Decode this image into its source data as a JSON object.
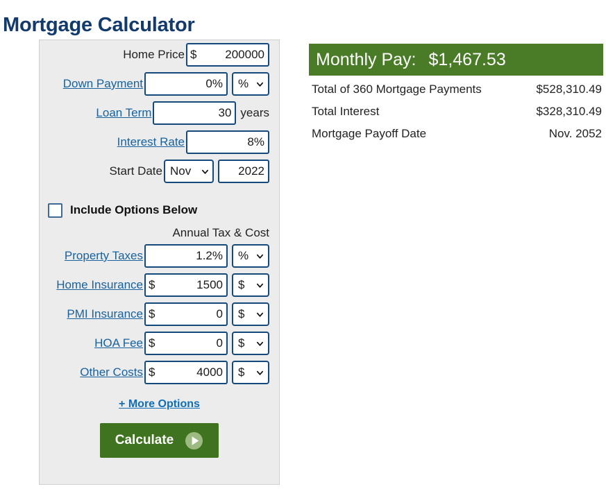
{
  "page": {
    "title": "Mortgage Calculator"
  },
  "calculator": {
    "fields": [
      {
        "id": "home-price",
        "label": "Home Price",
        "is_link": false,
        "prefix": "$",
        "value": "200000",
        "select": null,
        "suffix": null
      },
      {
        "id": "down-payment",
        "label": "Down Payment",
        "is_link": true,
        "prefix": "",
        "value": "0%",
        "select": "%",
        "suffix": null
      },
      {
        "id": "loan-term",
        "label": "Loan Term",
        "is_link": true,
        "prefix": "",
        "value": "30",
        "select": null,
        "suffix": "years"
      },
      {
        "id": "interest-rate",
        "label": "Interest Rate",
        "is_link": true,
        "prefix": "",
        "value": "8%",
        "select": null,
        "suffix": null
      }
    ],
    "start_date": {
      "label": "Start Date",
      "month": "Nov",
      "year": "2022"
    },
    "include_options": {
      "label": "Include Options Below",
      "checked": false
    },
    "annual_heading": "Annual Tax & Cost",
    "option_fields": [
      {
        "id": "property-taxes",
        "label": "Property Taxes",
        "is_link": true,
        "prefix": "",
        "value": "1.2%",
        "select": "%"
      },
      {
        "id": "home-insurance",
        "label": "Home Insurance",
        "is_link": true,
        "prefix": "$",
        "value": "1500",
        "select": "$"
      },
      {
        "id": "pmi-insurance",
        "label": "PMI Insurance",
        "is_link": true,
        "prefix": "$",
        "value": "0",
        "select": "$"
      },
      {
        "id": "hoa-fee",
        "label": "HOA Fee",
        "is_link": true,
        "prefix": "$",
        "value": "0",
        "select": "$"
      },
      {
        "id": "other-costs",
        "label": "Other Costs",
        "is_link": true,
        "prefix": "$",
        "value": "4000",
        "select": "$"
      }
    ],
    "more_options_label": "+ More Options",
    "calculate_label": "Calculate"
  },
  "results": {
    "monthly_pay_label": "Monthly Pay:",
    "monthly_pay_value": "$1,467.53",
    "rows": [
      {
        "label": "Total of 360 Mortgage Payments",
        "value": "$528,310.49"
      },
      {
        "label": "Total Interest",
        "value": "$328,310.49"
      },
      {
        "label": "Mortgage Payoff Date",
        "value": "Nov. 2052"
      }
    ]
  },
  "colors": {
    "title_blue": "#123a6d",
    "link_blue": "#17629e",
    "accent_link_blue": "#0e6eb8",
    "result_green": "#4a7c28",
    "button_green": "#3f7320",
    "panel_gray": "#ececec",
    "input_border": "#14497c"
  }
}
